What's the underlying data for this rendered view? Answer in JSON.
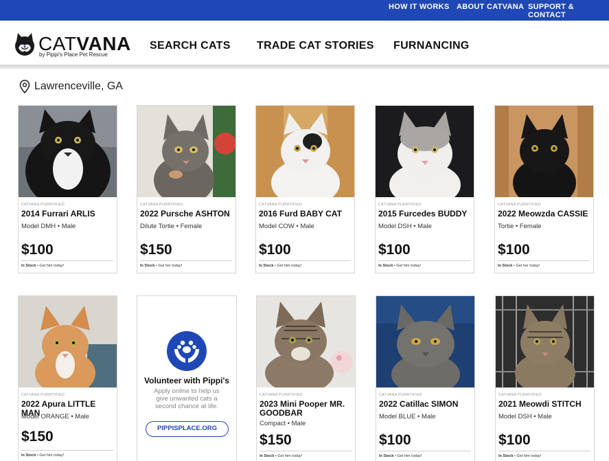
{
  "topbar": {
    "links": [
      "HOW IT WORKS",
      "ABOUT CATVANA",
      "SUPPORT & CONTACT"
    ],
    "background": "#1f48b6"
  },
  "brand": {
    "word_light": "CAT",
    "word_bold": "VANA",
    "subtitle": "by Pippi's Place Pet Rescue",
    "icon": "cat-head-logo-icon"
  },
  "nav": {
    "items": [
      "SEARCH CATS",
      "TRADE CAT STORIES",
      "FURNANCING"
    ]
  },
  "location": {
    "icon": "map-pin-icon",
    "label": "Lawrenceville, GA"
  },
  "cards": [
    {
      "tag": "CATVANA PURRTIFIED",
      "title": "2014 Furrari ARLIS",
      "model": "Model DMH • Male",
      "price": "$100",
      "stock_label": "In Stock",
      "stock_note": " • Get him today!"
    },
    {
      "tag": "CATVANA PURRTIFIED",
      "title": "2022 Pursche ASHTON",
      "model": "Dilute Tortie • Female",
      "price": "$150",
      "stock_label": "In Stock",
      "stock_note": " • Get her today!"
    },
    {
      "tag": "CATVANA PURRTIFIED",
      "title": "2016 Furd BABY CAT",
      "model": "Model COW • Male",
      "price": "$100",
      "stock_label": "In Stock",
      "stock_note": " • Get him today!"
    },
    {
      "tag": "CATVANA PURRTIFIED",
      "title": "2015 Furcedes BUDDY",
      "model": "Model DSH • Male",
      "price": "$100",
      "stock_label": "In Stock",
      "stock_note": " • Get him today!"
    },
    {
      "tag": "CATVANA PURRTIFIED",
      "title": "2022 Meowzda CASSIE",
      "model": "Tortie • Female",
      "price": "$100",
      "stock_label": "In Stock",
      "stock_note": " • Get her today!"
    },
    {
      "tag": "CATVANA PURRTIFIED",
      "title": "2022 Apura LITTLE MAN",
      "model": "Model ORANGE • Male",
      "price": "$150",
      "stock_label": "In Stock",
      "stock_note": " • Get him today!"
    },
    {
      "tag": "CATVANA PURRTIFIED",
      "title": "2023 Mini Pooper MR. GOODBAR",
      "model": "Compact • Male",
      "price": "$150",
      "stock_label": "In Stock",
      "stock_note": " • Get him today!"
    },
    {
      "tag": "CATVANA PURRTIFIED",
      "title": "2022 Catillac SIMON",
      "model": "Model BLUE • Male",
      "price": "$100",
      "stock_label": "In Stock",
      "stock_note": " • Get him today!"
    },
    {
      "tag": "CATVANA PURRTIFIED",
      "title": "2021 Meowdi STITCH",
      "model": "Model DSH • Male",
      "price": "$100",
      "stock_label": "In Stock",
      "stock_note": " • Get him today!"
    }
  ],
  "promo": {
    "icon": "hands-paw-icon",
    "title": "Volunteer with Pippi's",
    "body": "Apply online to help us give unwanted cats a second chance at life.",
    "button": "PIPPISPLACE.ORG"
  }
}
